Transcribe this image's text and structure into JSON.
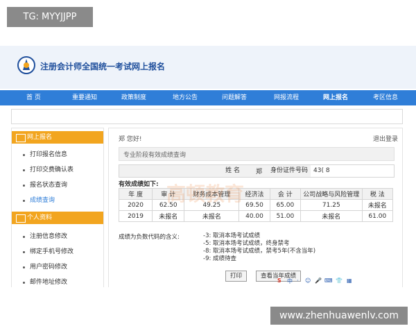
{
  "overlay_tag": "TG: MYYJJPP",
  "site": {
    "title": "注册会计师全国统一考试网上报名"
  },
  "nav": [
    "首  页",
    "重要通知",
    "政策制度",
    "地方公告",
    "问题解答",
    "网报流程",
    "网上报名",
    "考区信息"
  ],
  "sidebar": {
    "section1_title": "网上报名",
    "section1_items": [
      "打印报名信息",
      "打印交费确认表",
      "报名状态查询",
      "成绩查询"
    ],
    "section2_title": "个人资料",
    "section2_items": [
      "注册信息修改",
      "绑定手机号修改",
      "用户密码修改",
      "邮件地址修改"
    ]
  },
  "main": {
    "greeting": "郑    您好!",
    "logout": "退出登录",
    "query_title": "专业阶段有效成绩查询",
    "name_label": "姓    名",
    "name_value": "郑",
    "id_label": "身份证件号码",
    "id_value": "43(             8",
    "valid_label": "有效成绩如下:",
    "columns": [
      "年 度",
      "审 计",
      "财务成本管理",
      "经济法",
      "会 计",
      "公司战略与风险管理",
      "税 法"
    ],
    "rows": [
      [
        "2020",
        "62.50",
        "49.25",
        "69.50",
        "65.00",
        "71.25",
        "未报名"
      ],
      [
        "2019",
        "未报名",
        "未报名",
        "40.00",
        "51.00",
        "未报名",
        "61.00"
      ]
    ],
    "notes_title": "成绩为负数代码的含义:",
    "notes": [
      "-3:  取消本场考试成绩",
      "-5:  取消本场考试成绩，终身禁考",
      "-8:  取消本场考试成绩，禁考5年(不含当年)",
      "-9:  成绩待查"
    ],
    "print_button": "打印",
    "current_year_button": "查看当年成绩"
  },
  "ime_toolbar": [
    "S",
    "中",
    "·",
    "☺",
    "🎤",
    "⌨",
    "👕",
    "▦"
  ],
  "watermark_text": "高顿教育",
  "footer_tag": "www.zhenhuawenlv.com",
  "colors": {
    "nav_blue": "#2f7ed8",
    "sidebar_orange": "#f2a51f",
    "title_blue": "#1f4f9c"
  }
}
